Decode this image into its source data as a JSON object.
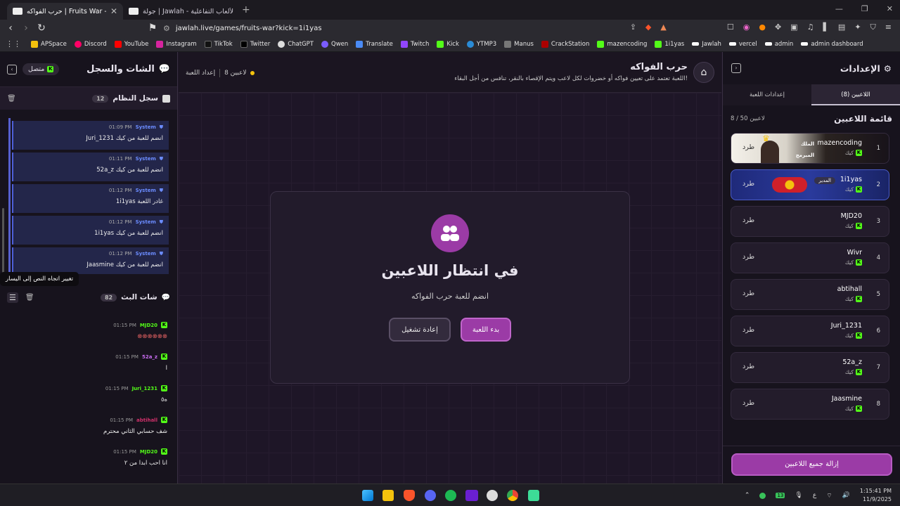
{
  "browser": {
    "tabs": [
      {
        "title": "حرب الفواكه | Fruits War - جولة",
        "active": true
      },
      {
        "title": "جولة | Jawlah - منصة الألعاب التفاعلية",
        "active": false
      }
    ],
    "url": "jawlah.live/games/fruits-war?kick=1i1yas",
    "bookmarks": [
      "APSpace",
      "Discord",
      "YouTube",
      "Instagram",
      "TikTok",
      "Twitter",
      "ChatGPT",
      "Qwen",
      "Translate",
      "Twitch",
      "Kick",
      "YTMP3",
      "Manus",
      "CrackStation",
      "mazencoding",
      "1i1yas",
      "Jawlah",
      "vercel",
      "admin",
      "admin dashboard"
    ]
  },
  "chat": {
    "title": "الشات والسجل",
    "status": "متصل",
    "system_log": {
      "title": "سجل النظام",
      "count": "12",
      "messages": [
        {
          "sender": "System",
          "time": "01:09 PM",
          "text": "Juri_1231 انضم للعبة من كيك"
        },
        {
          "sender": "System",
          "time": "01:11 PM",
          "text": "52a_z انضم للعبة من كيك"
        },
        {
          "sender": "System",
          "time": "01:12 PM",
          "text": "1i1yas غادر اللعبة"
        },
        {
          "sender": "System",
          "time": "01:12 PM",
          "text": "1i1yas انضم للعبة من كيك"
        },
        {
          "sender": "System",
          "time": "01:12 PM",
          "text": "Jaasmine انضم للعبة من كيك"
        }
      ]
    },
    "tooltip": "تغيير اتجاه النص إلى اليسار",
    "stream_chat": {
      "title": "شات البث",
      "count": "82",
      "messages": [
        {
          "user": "MJD20",
          "time": "01:15 PM",
          "text": "⊗⊗⊗⊗⊗⊗",
          "color": "#53fc18"
        },
        {
          "user": "52a_z",
          "time": "01:15 PM",
          "text": "ا",
          "color": "#c86cf0"
        },
        {
          "user": "Juri_1231",
          "time": "01:15 PM",
          "text": "ه٥",
          "color": "#53fc18"
        },
        {
          "user": "abtihall",
          "time": "01:15 PM",
          "text": "شف حسابي الثاني محترم",
          "color": "#d0306a"
        },
        {
          "user": "MJD20",
          "time": "01:15 PM",
          "text": "انا احب ابدا من ٢",
          "color": "#53fc18"
        }
      ]
    }
  },
  "game": {
    "title": "حرب الفواكه",
    "description": "اللعبة تعتمد على تعيين فواكه أو خضروات لكل لاعب ويتم الإقصاء بالنقر، تنافس من أجل البقاء!",
    "players_count": "8 لاعبين",
    "setup_label": "إعداد اللعبة",
    "waiting_title": "في انتظار اللاعبين",
    "waiting_sub": "انضم للعبة حرب الفواكه",
    "start_button": "بدء اللعبة",
    "restart_button": "إعادة تشغيل"
  },
  "settings": {
    "title": "الإعدادات",
    "tabs": [
      "اللاعبين (8)",
      "إعدادات اللعبة"
    ],
    "list_title": "قائمة اللاعبين",
    "list_count": "8 / 50 لاعبين",
    "kick_label": "طرد",
    "platform": "كيك",
    "players": [
      {
        "num": "1",
        "name": "mazencoding",
        "badge": "الملك",
        "badge2": "المبرمج"
      },
      {
        "num": "2",
        "name": "1i1yas",
        "badge": "المدير"
      },
      {
        "num": "3",
        "name": "MJD20"
      },
      {
        "num": "4",
        "name": "Wivr"
      },
      {
        "num": "5",
        "name": "abtihall"
      },
      {
        "num": "6",
        "name": "Juri_1231"
      },
      {
        "num": "7",
        "name": "52a_z"
      },
      {
        "num": "8",
        "name": "Jaasmine"
      }
    ],
    "remove_all": "إزالة جميع اللاعبين"
  },
  "taskbar": {
    "time": "1:15:41 PM",
    "date": "11/9/2025",
    "lang": "ع",
    "battery": "13"
  }
}
